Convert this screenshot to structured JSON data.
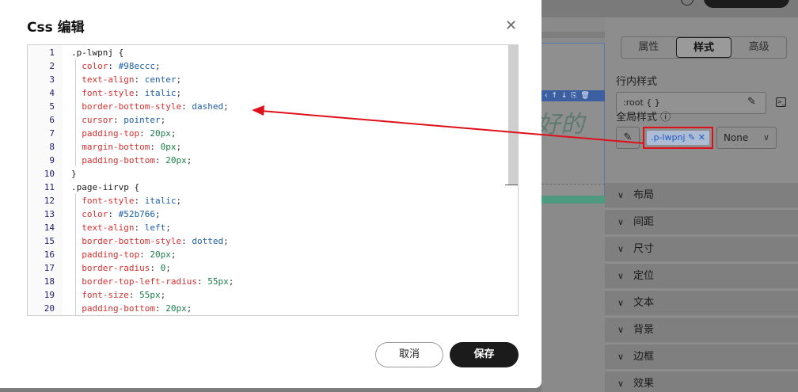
{
  "modal": {
    "title": "Css 编辑",
    "close_glyph": "✕",
    "cancel_label": "取消",
    "save_label": "保存"
  },
  "code_lines": [
    {
      "n": "1",
      "parts": [
        [
          ".p-lwpnj {",
          "sel"
        ]
      ]
    },
    {
      "n": "2",
      "parts": [
        [
          "  color",
          "prop"
        ],
        [
          ": ",
          "punc"
        ],
        [
          "#98eccc",
          "val"
        ],
        [
          ";",
          "punc"
        ]
      ]
    },
    {
      "n": "3",
      "parts": [
        [
          "  text-align",
          "prop"
        ],
        [
          ": ",
          "punc"
        ],
        [
          "center",
          "val"
        ],
        [
          ";",
          "punc"
        ]
      ]
    },
    {
      "n": "4",
      "parts": [
        [
          "  font-style",
          "prop"
        ],
        [
          ": ",
          "punc"
        ],
        [
          "italic",
          "val"
        ],
        [
          ";",
          "punc"
        ]
      ]
    },
    {
      "n": "5",
      "parts": [
        [
          "  border-bottom-style",
          "prop"
        ],
        [
          ": ",
          "punc"
        ],
        [
          "dashed",
          "val"
        ],
        [
          ";",
          "punc"
        ]
      ]
    },
    {
      "n": "6",
      "parts": [
        [
          "  cursor",
          "prop"
        ],
        [
          ": ",
          "punc"
        ],
        [
          "pointer",
          "val"
        ],
        [
          ";",
          "punc"
        ]
      ]
    },
    {
      "n": "7",
      "parts": [
        [
          "  padding-top",
          "prop"
        ],
        [
          ": ",
          "punc"
        ],
        [
          "20px",
          "num"
        ],
        [
          ";",
          "punc"
        ]
      ]
    },
    {
      "n": "8",
      "parts": [
        [
          "  margin-bottom",
          "prop"
        ],
        [
          ": ",
          "punc"
        ],
        [
          "0px",
          "num"
        ],
        [
          ";",
          "punc"
        ]
      ]
    },
    {
      "n": "9",
      "parts": [
        [
          "  padding-bottom",
          "prop"
        ],
        [
          ": ",
          "punc"
        ],
        [
          "20px",
          "num"
        ],
        [
          ";",
          "punc"
        ]
      ]
    },
    {
      "n": "10",
      "parts": [
        [
          "}",
          "sel"
        ]
      ]
    },
    {
      "n": "11",
      "parts": [
        [
          ".page-iirvp {",
          "sel"
        ]
      ]
    },
    {
      "n": "12",
      "parts": [
        [
          "  font-style",
          "prop"
        ],
        [
          ": ",
          "punc"
        ],
        [
          "italic",
          "val"
        ],
        [
          ";",
          "punc"
        ]
      ]
    },
    {
      "n": "13",
      "parts": [
        [
          "  color",
          "prop"
        ],
        [
          ": ",
          "punc"
        ],
        [
          "#52b766",
          "val"
        ],
        [
          ";",
          "punc"
        ]
      ]
    },
    {
      "n": "14",
      "parts": [
        [
          "  text-align",
          "prop"
        ],
        [
          ": ",
          "punc"
        ],
        [
          "left",
          "val"
        ],
        [
          ";",
          "punc"
        ]
      ]
    },
    {
      "n": "15",
      "parts": [
        [
          "  border-bottom-style",
          "prop"
        ],
        [
          ": ",
          "punc"
        ],
        [
          "dotted",
          "val"
        ],
        [
          ";",
          "punc"
        ]
      ]
    },
    {
      "n": "16",
      "parts": [
        [
          "  padding-top",
          "prop"
        ],
        [
          ": ",
          "punc"
        ],
        [
          "20px",
          "num"
        ],
        [
          ";",
          "punc"
        ]
      ]
    },
    {
      "n": "17",
      "parts": [
        [
          "  border-radius",
          "prop"
        ],
        [
          ": ",
          "punc"
        ],
        [
          "0",
          "num"
        ],
        [
          ";",
          "punc"
        ]
      ]
    },
    {
      "n": "18",
      "parts": [
        [
          "  border-top-left-radius",
          "prop"
        ],
        [
          ": ",
          "punc"
        ],
        [
          "55px",
          "num"
        ],
        [
          ";",
          "punc"
        ]
      ]
    },
    {
      "n": "19",
      "parts": [
        [
          "  font-size",
          "prop"
        ],
        [
          ": ",
          "punc"
        ],
        [
          "55px",
          "num"
        ],
        [
          ";",
          "punc"
        ]
      ]
    },
    {
      "n": "20",
      "parts": [
        [
          "  padding-bottom",
          "prop"
        ],
        [
          ": ",
          "punc"
        ],
        [
          "20px",
          "num"
        ],
        [
          ";",
          "punc"
        ]
      ]
    }
  ],
  "canvas": {
    "toolbar_glyphs": "‹ ↑ ↓ ⎘ 🗑",
    "preview_text": "好的"
  },
  "right_panel": {
    "tabs": [
      {
        "label": "属性",
        "active": false
      },
      {
        "label": "样式",
        "active": true
      },
      {
        "label": "高级",
        "active": false
      }
    ],
    "inline_style_label": "行内样式",
    "inline_style_value": ":root { }",
    "global_style_label": "全局样式 ⓘ",
    "class_tag": ".p-lwpnj",
    "select_value": "None",
    "accordion": [
      "布局",
      "间距",
      "尺寸",
      "定位",
      "文本",
      "背景",
      "边框",
      "效果"
    ]
  },
  "colors": {
    "annotation_red": "#e0101a",
    "save_bg": "#1b1b1b",
    "prop": "#d72f2f",
    "value": "#1b5ea8",
    "number": "#1a7f4a"
  },
  "icons": {
    "edit": "edit-icon",
    "close": "close-icon",
    "terminal": "terminal-icon",
    "chevron": "chevron-down-icon",
    "help": "help-circle-icon"
  }
}
